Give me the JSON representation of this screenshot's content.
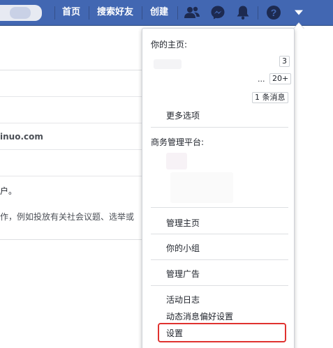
{
  "nav": {
    "home": "首页",
    "find_friends": "搜索好友",
    "create": "创建",
    "icons": [
      "friends-icon",
      "messenger-icon",
      "notifications-icon",
      "help-icon",
      "dropdown-arrow-icon"
    ]
  },
  "background": {
    "domain_fragment": "inuo.com",
    "account_fragment": "户。",
    "ads_fragment": "作，例如投放有关社会议题、选举或"
  },
  "dropdown": {
    "pages_heading": "你的主页:",
    "page_badge_1": "3",
    "page_badge_2_prefix": "...",
    "page_badge_2": "20+",
    "page_badge_3": "1 条消息",
    "more_options": "更多选项",
    "business_heading": "商务管理平台:",
    "manage_pages": "管理主页",
    "your_groups": "你的小组",
    "manage_ads": "管理广告",
    "activity_log": "活动日志",
    "news_feed_prefs": "动态消息偏好设置",
    "settings": "设置"
  },
  "colors": {
    "nav_bg": "#4267b2",
    "highlight": "#e0322f"
  }
}
